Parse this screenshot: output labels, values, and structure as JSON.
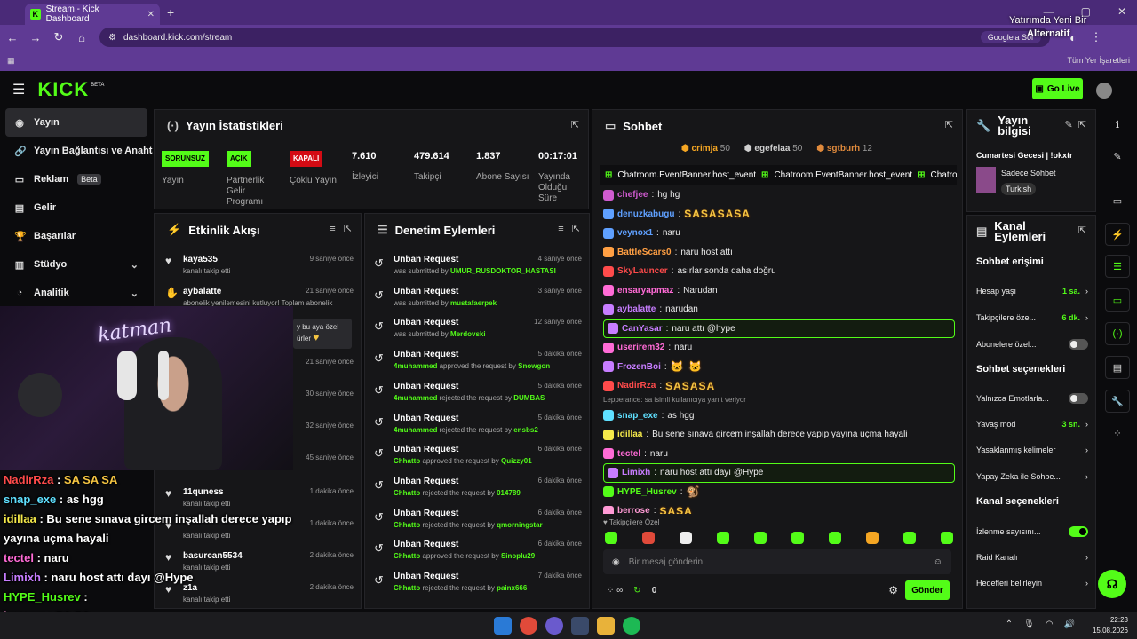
{
  "browser": {
    "tab_title": "Stream - Kick Dashboard",
    "url": "dashboard.kick.com/stream",
    "google_lens": "Google'a Sor",
    "bookmarks_all": "Tüm Yer İşaretleri",
    "notification": [
      "Yatırımda Yeni Bir",
      "Alternatif"
    ]
  },
  "header": {
    "logo": "KICK",
    "logo_tag": "BETA",
    "go_live": "Go Live"
  },
  "sidebar": {
    "items": [
      {
        "label": "Yayın",
        "icon": "broadcast-icon"
      },
      {
        "label": "Yayın Bağlantısı ve Anahtarı",
        "icon": "link-icon"
      },
      {
        "label": "Reklam",
        "icon": "ad-icon",
        "badge": "Beta"
      },
      {
        "label": "Gelir",
        "icon": "revenue-icon"
      },
      {
        "label": "Başarılar",
        "icon": "trophy-icon"
      },
      {
        "label": "Stüdyo",
        "icon": "studio-icon"
      },
      {
        "label": "Analitik",
        "icon": "analytics-icon"
      }
    ]
  },
  "stats": {
    "title": "Yayın İstatistikleri",
    "cols": [
      {
        "badge": "SORUNSUZ",
        "label": "Yayın"
      },
      {
        "badge": "AÇIK",
        "label": "Partnerlik Gelir Programı"
      },
      {
        "badge": "KAPALI",
        "label": "Çoklu Yayın"
      },
      {
        "value": "7.610",
        "label": "İzleyici"
      },
      {
        "value": "479.614",
        "label": "Takipçi"
      },
      {
        "value": "1.837",
        "label": "Abone Sayısı"
      },
      {
        "value": "00:17:01",
        "label": "Yayında Olduğu Süre"
      }
    ]
  },
  "activity": {
    "title": "Etkinlik Akışı",
    "rows": [
      {
        "name": "kaya535",
        "sub": "kanalı takip etti",
        "time": "9 saniye önce"
      },
      {
        "name": "aybalatte",
        "sub": "abonelik yenilemesini kutluyor! Toplam abonelik",
        "time": "21 saniye önce"
      },
      {
        "name": "",
        "sub": "",
        "time": "21 saniye önce"
      },
      {
        "name": "",
        "sub": "",
        "time": "30 saniye önce"
      },
      {
        "name": "",
        "sub": "",
        "time": "32 saniye önce"
      },
      {
        "name": "",
        "sub": "",
        "time": "45 saniye önce"
      },
      {
        "name": "11quness",
        "sub": "kanalı takip etti",
        "time": "1 dakika önce"
      },
      {
        "name": "",
        "sub": "kanalı takip etti",
        "time": "1 dakika önce"
      },
      {
        "name": "basurcan5534",
        "sub": "kanalı takip etti",
        "time": "2 dakika önce"
      },
      {
        "name": "z1a",
        "sub": "kanalı takip etti",
        "time": "2 dakika önce"
      }
    ],
    "highlight": [
      "y bu aya özel",
      "ürler"
    ]
  },
  "moderation": {
    "title": "Denetim Eylemleri",
    "rows": [
      {
        "title": "Unban Request",
        "pre": "was submitted by",
        "user": "UMUR_RUSDOKTOR_HASTASI",
        "post": "",
        "time": "4 saniye önce"
      },
      {
        "title": "Unban Request",
        "pre": "was submitted by",
        "user": "mustafaerpek",
        "post": "",
        "time": "3 saniye önce"
      },
      {
        "title": "Unban Request",
        "pre": "was submitted by",
        "user": "Merdovski",
        "post": "",
        "time": "12 saniye önce"
      },
      {
        "title": "Unban Request",
        "pre": "",
        "user": "4muhammed",
        "post": "approved the request by",
        "target": "Snowgon",
        "time": "5 dakika önce"
      },
      {
        "title": "Unban Request",
        "pre": "",
        "user": "4muhammed",
        "post": "rejected the request by",
        "target": "DUMBAS",
        "time": "5 dakika önce"
      },
      {
        "title": "Unban Request",
        "pre": "",
        "user": "4muhammed",
        "post": "rejected the request by",
        "target": "ensbs2",
        "time": "5 dakika önce"
      },
      {
        "title": "Unban Request",
        "pre": "",
        "user": "Chhatto",
        "post": "approved the request by",
        "target": "Quizzy01",
        "time": "6 dakika önce"
      },
      {
        "title": "Unban Request",
        "pre": "",
        "user": "Chhatto",
        "post": "rejected the request by",
        "target": "014789",
        "time": "6 dakika önce"
      },
      {
        "title": "Unban Request",
        "pre": "",
        "user": "Chhatto",
        "post": "rejected the request by",
        "target": "qmorningstar",
        "time": "6 dakika önce"
      },
      {
        "title": "Unban Request",
        "pre": "",
        "user": "Chhatto",
        "post": "approved the request by",
        "target": "Sinoplu29",
        "time": "6 dakika önce"
      },
      {
        "title": "Unban Request",
        "pre": "",
        "user": "Chhatto",
        "post": "rejected the request by",
        "target": "painx666",
        "time": "7 dakika önce"
      }
    ]
  },
  "chat": {
    "title": "Sohbet",
    "leaders": [
      {
        "name": "crimja",
        "count": "50",
        "color": "#f5a623"
      },
      {
        "name": "egefelaa",
        "count": "50",
        "color": "#cfcfcf"
      },
      {
        "name": "sgtburh",
        "count": "12",
        "color": "#e08a3c"
      }
    ],
    "banner": [
      "Chatroom.EventBanner.host_event",
      "Chatroom.EventBanner.host_event",
      "Chatroo"
    ],
    "messages": [
      {
        "user": "chefjee",
        "text": "hg hg",
        "color": "#d05bd0"
      },
      {
        "user": "denuzkabugu",
        "text": "",
        "emote": "SASASASA",
        "color": "#5fa0ff"
      },
      {
        "user": "veynox1",
        "text": "naru",
        "color": "#5fa0ff"
      },
      {
        "user": "BattleScars0",
        "text": "naru host attı",
        "color": "#ff9f43"
      },
      {
        "user": "SkyLauncer",
        "text": "asırlar sonda daha doğru",
        "color": "#ff4b4b"
      },
      {
        "user": "ensaryapmaz",
        "text": "Narudan",
        "color": "#ff6bd6"
      },
      {
        "user": "aybalatte",
        "text": "narudan",
        "color": "#c77dff"
      },
      {
        "user": "CanYasar",
        "text": "naru attı @hype",
        "color": "#c77dff",
        "hl": true
      },
      {
        "user": "userirem32",
        "text": "naru",
        "color": "#ff6bd6"
      },
      {
        "user": "FrozenBoi",
        "text": "",
        "emote": "🐱 🐱",
        "color": "#c77dff"
      },
      {
        "user": "NadirRza",
        "text": "",
        "emote": "SASASA",
        "color": "#ff4b4b"
      },
      {
        "reply": "Lepperance: sa isimli kullanıcıya yanıt veriyor"
      },
      {
        "user": "snap_exe",
        "text": "as hgg",
        "color": "#5fe0ff"
      },
      {
        "user": "idillaa",
        "text": "Bu sene sınava gircem inşallah derece yapıp yayına uçma hayali",
        "color": "#f5e94a"
      },
      {
        "user": "tectel",
        "text": "naru",
        "color": "#ff6bd6"
      },
      {
        "user": "Limixh",
        "text": "naru host attı dayı @Hype",
        "color": "#c77dff",
        "hl": true
      },
      {
        "user": "HYPE_Husrev",
        "text": "",
        "emote": "🐒",
        "color": "#53fc18"
      },
      {
        "user": "berrose",
        "text": "",
        "emote": "SASA",
        "color": "#ff9ad5"
      }
    ],
    "subs_only": "Takipçilere Özel",
    "input_placeholder": "Bir mesaj gönderin",
    "points": "0",
    "send": "Gönder"
  },
  "stream_info": {
    "title": "Yayın bilgisi",
    "stream_title": "Cumartesi Gecesi | !okxtr",
    "category": "Sadece Sohbet",
    "language": "Turkish"
  },
  "channel_actions": {
    "title": "Kanal Eylemleri",
    "chat_access": "Sohbet erişimi",
    "items1": [
      {
        "label": "Hesap yaşı",
        "value": "1 sa."
      },
      {
        "label": "Takipçilere öze...",
        "value": "6 dk."
      },
      {
        "label": "Abonelere özel...",
        "toggle": false
      }
    ],
    "chat_options": "Sohbet seçenekleri",
    "items2": [
      {
        "label": "Yalnızca Emotlarla...",
        "toggle": false
      },
      {
        "label": "Yavaş mod",
        "value": "3 sn."
      },
      {
        "label": "Yasaklanmış kelimeler"
      },
      {
        "label": "Yapay Zeka ile Sohbe..."
      }
    ],
    "channel_options": "Kanal seçenekleri",
    "items3": [
      {
        "label": "İzlenme sayısını...",
        "toggle": true
      },
      {
        "label": "Raid Kanalı"
      },
      {
        "label": "Hedefleri belirleyin"
      }
    ]
  },
  "overlay_chat": [
    {
      "user": "NadirRza",
      "text": "SA SA SA",
      "color": "#ff4b4b"
    },
    {
      "user": "snap_exe",
      "text": "as hgg",
      "color": "#5fe0ff"
    },
    {
      "user": "idillaa",
      "text": "Bu sene sınava gircem inşallah derece yapıp",
      "color": "#f5e94a"
    },
    {
      "user": "",
      "text": "yayına uçma hayali",
      "color": "#fff"
    },
    {
      "user": "tectel",
      "text": "naru",
      "color": "#ff6bd6"
    },
    {
      "user": "Limixh",
      "text": "naru host attı dayı @Hype",
      "color": "#c77dff"
    },
    {
      "user": "HYPE_Husrev",
      "text": "",
      "color": "#53fc18"
    },
    {
      "user": "berrose",
      "text": "SA SA",
      "color": "#ff9ad5"
    }
  ],
  "stream_overlay_text": "katman",
  "taskbar": {
    "time": "22:23",
    "date": "15.08.2026"
  }
}
